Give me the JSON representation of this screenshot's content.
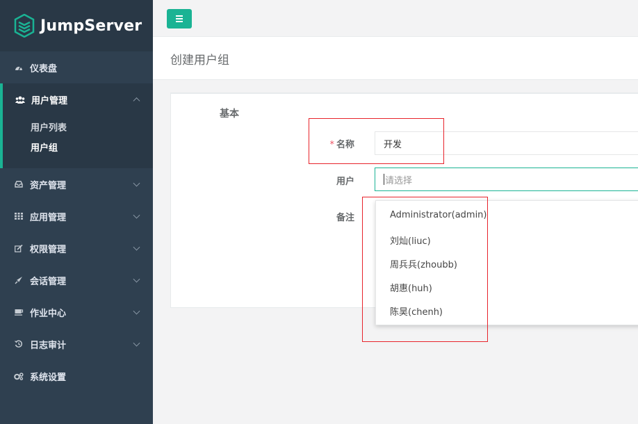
{
  "brand": {
    "name": "JumpServer"
  },
  "sidebar": {
    "items": [
      {
        "label": "仪表盘",
        "icon": "dashboard-icon"
      },
      {
        "label": "用户管理",
        "icon": "users-icon",
        "expanded": true,
        "children": [
          {
            "label": "用户列表"
          },
          {
            "label": "用户组",
            "current": true
          }
        ]
      },
      {
        "label": "资产管理",
        "icon": "inbox-icon"
      },
      {
        "label": "应用管理",
        "icon": "grid-icon"
      },
      {
        "label": "权限管理",
        "icon": "edit-icon"
      },
      {
        "label": "会话管理",
        "icon": "rocket-icon"
      },
      {
        "label": "作业中心",
        "icon": "coffee-icon"
      },
      {
        "label": "日志审计",
        "icon": "history-icon"
      },
      {
        "label": "系统设置",
        "icon": "gears-icon"
      }
    ]
  },
  "page": {
    "title": "创建用户组"
  },
  "form": {
    "section": "基本",
    "name_label": "名称",
    "name_required": "*",
    "name_value": "开发",
    "users_label": "用户",
    "users_placeholder": "请选择",
    "comment_label": "备注",
    "user_options": [
      "Administrator(admin)",
      "刘灿(liuc)",
      "周兵兵(zhoubb)",
      "胡惠(huh)",
      "陈昊(chenh)"
    ]
  },
  "colors": {
    "accent": "#1ab394",
    "sidebar": "#2f4050",
    "highlight": "#e8232b"
  }
}
